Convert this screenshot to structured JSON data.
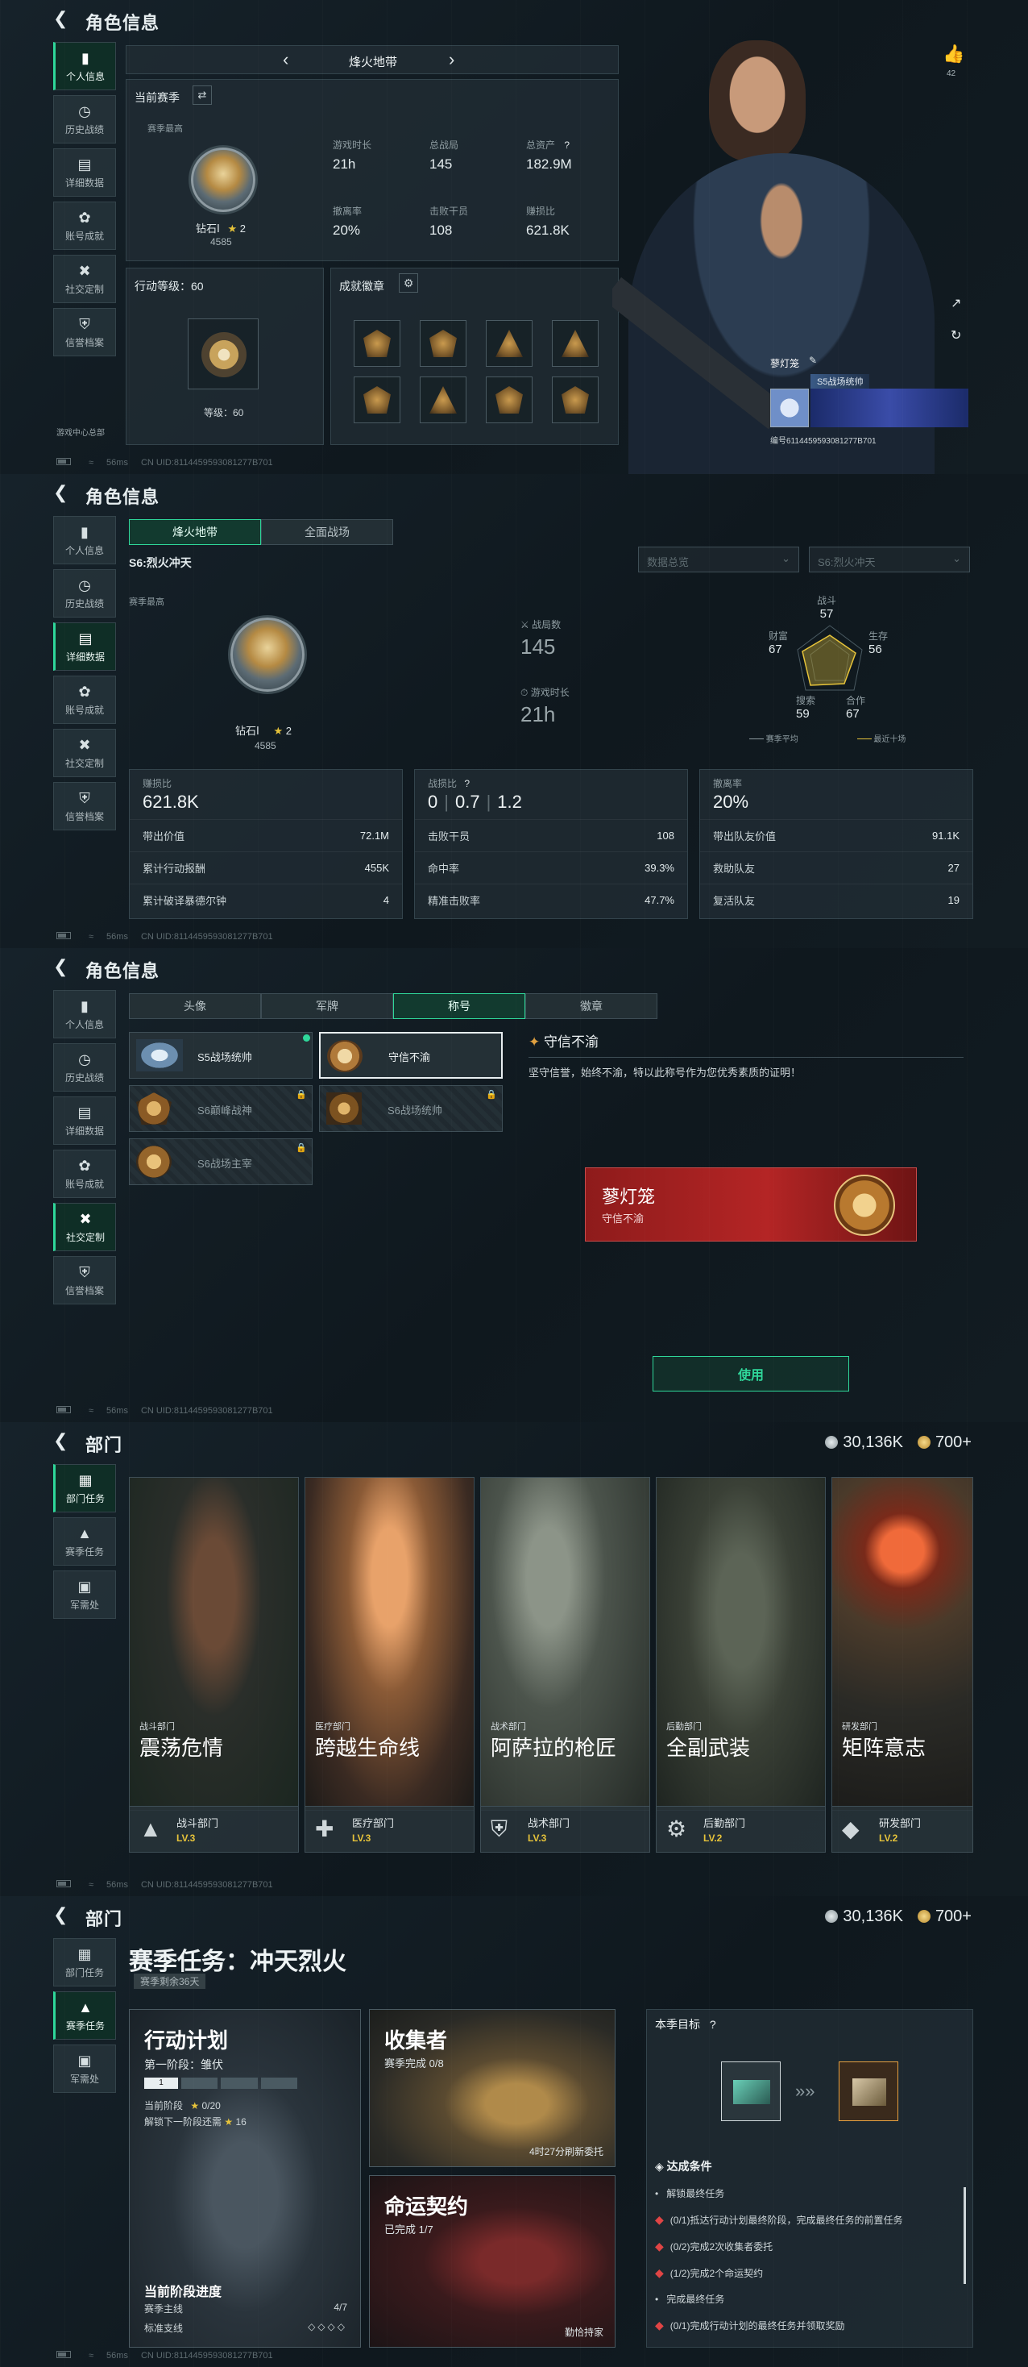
{
  "s1": {
    "title": "角色信息",
    "sidebar": [
      "个人信息",
      "历史战绩",
      "详细数据",
      "账号成就",
      "社交定制",
      "信誉档案"
    ],
    "season_nav": "烽火地带",
    "current_season": "当前赛季",
    "season_best": "赛季最高",
    "rank_name": "钻石Ⅰ",
    "rank_stars": "2",
    "rank_points": "4585",
    "stats": [
      {
        "label": "游戏时长",
        "value": "21h"
      },
      {
        "label": "总战局",
        "value": "145"
      },
      {
        "label": "总资产",
        "value": "182.9M"
      },
      {
        "label": "撤离率",
        "value": "20%"
      },
      {
        "label": "击败干员",
        "value": "108"
      },
      {
        "label": "赚损比",
        "value": "621.8K"
      }
    ],
    "asset_help": "?",
    "action_level_label": "行动等级：60",
    "level_text": "等级：60",
    "badges_label": "成就徽章",
    "likes": "42",
    "player_name": "蓼灯笼",
    "player_title": "S5战场统帅",
    "player_id": "编号6114459593081277B701",
    "online_center": "游戏中心总部",
    "footer_ping": "56ms",
    "footer_uid": "CN UID:8114459593081277B701"
  },
  "s2": {
    "title": "角色信息",
    "sidebar": [
      "个人信息",
      "历史战绩",
      "详细数据",
      "账号成就",
      "社交定制",
      "信誉档案"
    ],
    "tabs": [
      "烽火地带",
      "全面战场"
    ],
    "season": "S6:烈火冲天",
    "dropdown1": "数据总览",
    "dropdown2": "S6:烈火冲天",
    "season_best": "赛季最高",
    "rank_name": "钻石Ⅰ",
    "rank_stars": "2",
    "rank_points": "4585",
    "battles_label": "战局数",
    "battles": "145",
    "time_label": "游戏时长",
    "time": "21h",
    "radar": {
      "top_label": "战斗",
      "top": "57",
      "tr_label": "生存",
      "tr": "56",
      "tl_label": "财富",
      "tl": "67",
      "bl_label": "搜索",
      "bl": "59",
      "br_label": "合作",
      "br": "67",
      "legend1": "赛季平均",
      "legend2": "最近十场"
    },
    "col1": {
      "label": "赚损比",
      "value": "621.8K",
      "rows": [
        [
          "带出价值",
          "72.1M"
        ],
        [
          "累计行动报酬",
          "455K"
        ],
        [
          "累计破译暴德尔钟",
          "4"
        ]
      ]
    },
    "col2": {
      "label": "战损比",
      "help": "?",
      "values": [
        "0",
        "0.7",
        "1.2"
      ],
      "rows": [
        [
          "击败干员",
          "108"
        ],
        [
          "命中率",
          "39.3%"
        ],
        [
          "精准击败率",
          "47.7%"
        ]
      ]
    },
    "col3": {
      "label": "撤离率",
      "value": "20%",
      "rows": [
        [
          "带出队友价值",
          "91.1K"
        ],
        [
          "救助队友",
          "27"
        ],
        [
          "复活队友",
          "19"
        ]
      ]
    },
    "footer_ping": "56ms",
    "footer_uid": "CN UID:8114459593081277B701"
  },
  "s3": {
    "title": "角色信息",
    "sidebar": [
      "个人信息",
      "历史战绩",
      "详细数据",
      "账号成就",
      "社交定制",
      "信誉档案"
    ],
    "tabs": [
      "头像",
      "军牌",
      "称号",
      "徽章"
    ],
    "titles": [
      "S5战场统帅",
      "守信不渝",
      "S6巅峰战神",
      "S6战场统帅",
      "S6战场主宰"
    ],
    "detail_name": "守信不渝",
    "detail_desc": "坚守信誉，始终不渝，特以此称号作为您优秀素质的证明！",
    "preview_name": "蓼灯笼",
    "preview_title": "守信不渝",
    "use_button": "使用",
    "footer_ping": "56ms",
    "footer_uid": "CN UID:8114459593081277B701"
  },
  "s4": {
    "title": "部门",
    "sidebar": [
      "部门任务",
      "赛季任务",
      "军需处"
    ],
    "currency1": "30,136K",
    "currency2": "700+",
    "cards": [
      {
        "sub": "战斗部门",
        "title": "震荡危情",
        "dept": "战斗部门",
        "lv": "LV.3"
      },
      {
        "sub": "医疗部门",
        "title": "跨越生命线",
        "dept": "医疗部门",
        "lv": "LV.3"
      },
      {
        "sub": "战术部门",
        "title": "阿萨拉的枪匠",
        "dept": "战术部门",
        "lv": "LV.3"
      },
      {
        "sub": "后勤部门",
        "title": "全副武装",
        "dept": "后勤部门",
        "lv": "LV.2"
      },
      {
        "sub": "研发部门",
        "title": "矩阵意志",
        "dept": "研发部门",
        "lv": "LV.2"
      }
    ],
    "footer_ping": "56ms",
    "footer_uid": "CN UID:8114459593081277B701"
  },
  "s5": {
    "title": "部门",
    "sidebar": [
      "部门任务",
      "赛季任务",
      "军需处"
    ],
    "currency1": "30,136K",
    "currency2": "700+",
    "heading": "赛季任务：冲天烈火",
    "remaining": "赛季剩余36天",
    "plan": {
      "title": "行动计划",
      "stage": "第一阶段：雏伏",
      "cur_stage": "当前阶段",
      "cur_val": "0/20",
      "unlock": "解锁下一阶段还需",
      "unlock_val": "16",
      "progress_title": "当前阶段进度",
      "main": "赛季主线",
      "main_val": "4/7",
      "side": "标准支线",
      "step": "1"
    },
    "collector": {
      "title": "收集者",
      "progress": "赛季完成 0/8",
      "refresh": "4时27分刷新委托"
    },
    "fate": {
      "title": "命运契约",
      "progress": "已完成 1/7",
      "holder": "勤恰持家"
    },
    "goal": {
      "title": "本季目标",
      "help": "?",
      "cond_title": "达成条件",
      "items": [
        {
          "text": "解锁最终任务",
          "warn": false
        },
        {
          "text": "(0/1)抵达行动计划最终阶段，完成最终任务的前置任务",
          "warn": true
        },
        {
          "text": "(0/2)完成2次收集者委托",
          "warn": true
        },
        {
          "text": "(1/2)完成2个命运契约",
          "warn": true
        },
        {
          "text": "完成最终任务",
          "warn": false
        },
        {
          "text": "(0/1)完成行动计划的最终任务并领取奖励",
          "warn": true
        }
      ]
    },
    "footer_ping": "56ms",
    "footer_uid": "CN UID:8114459593081277B701"
  },
  "colors": {
    "accent": "#2fd79a",
    "gold": "#e6c33a",
    "red": "#e04545"
  }
}
